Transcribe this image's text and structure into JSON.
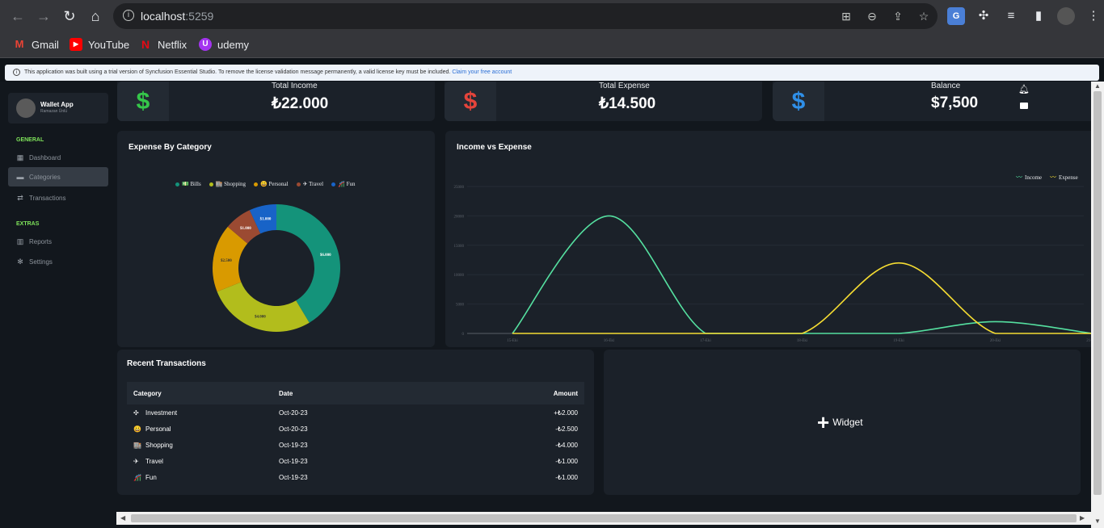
{
  "browser": {
    "url_host": "localhost",
    "url_port": ":5259",
    "ext_translate": "G"
  },
  "bookmarks": [
    {
      "label": "Gmail",
      "icon": "gmail-icon",
      "icon_text": "M",
      "color": "#ea4335"
    },
    {
      "label": "YouTube",
      "icon": "youtube-icon",
      "icon_text": "▶",
      "color": "#ff0000"
    },
    {
      "label": "Netflix",
      "icon": "netflix-icon",
      "icon_text": "N",
      "color": "#e50914"
    },
    {
      "label": "udemy",
      "icon": "udemy-icon",
      "icon_text": "U",
      "color": "#a435f0"
    }
  ],
  "banner": {
    "text": "This application was built using a trial version of Syncfusion Essential Studio. To remove the license validation message permanently, a valid license key must be included.",
    "link": "Claim your free account"
  },
  "sidebar": {
    "app_name": "Wallet App",
    "user_sub": "Ramazan Ünlü",
    "general_label": "GENERAL",
    "extras_label": "EXTRAS",
    "items": [
      {
        "label": "Dashboard",
        "icon": "calendar-icon"
      },
      {
        "label": "Categories",
        "icon": "folder-icon"
      },
      {
        "label": "Transactions",
        "icon": "exchange-icon"
      },
      {
        "label": "Reports",
        "icon": "bar-chart-icon"
      },
      {
        "label": "Settings",
        "icon": "gear-icon"
      }
    ]
  },
  "stats": [
    {
      "label": "Total Income",
      "value": "₺22.000",
      "color": "#35c74a"
    },
    {
      "label": "Total Expense",
      "value": "₺14.500",
      "color": "#e5443b"
    },
    {
      "label": "Balance",
      "value": "$7,500",
      "color": "#2f8fe8"
    }
  ],
  "donut": {
    "title": "Expense By Category",
    "legend": [
      "💵 Bills",
      "🏬 Shopping",
      "😀 Personal",
      "✈ Travel",
      "🎢 Fun"
    ],
    "colors": [
      "#14937a",
      "#b2bd1c",
      "#d99a00",
      "#9b4a32",
      "#1863c7"
    ]
  },
  "line": {
    "title": "Income vs Expense",
    "legend": [
      "Income",
      "Expense"
    ],
    "colors": [
      "#55e0a0",
      "#f5dc32"
    ],
    "y_ticks": [
      "25000",
      "20000",
      "15000",
      "10000",
      "5000",
      "0"
    ],
    "x_ticks": [
      "15-Eki",
      "16-Eki",
      "17-Eki",
      "18-Eki",
      "19-Eki",
      "20-Eki",
      "21-Eki"
    ]
  },
  "chart_data": [
    {
      "type": "pie",
      "title": "Expense By Category",
      "categories": [
        "Bills",
        "Shopping",
        "Personal",
        "Travel",
        "Fun"
      ],
      "values": [
        6000,
        4000,
        2500,
        1000,
        1000
      ],
      "labels": [
        "$6.000",
        "$4.000",
        "$2.500",
        "$1.000",
        "$1.000"
      ]
    },
    {
      "type": "line",
      "title": "Income vs Expense",
      "categories": [
        "15-Eki",
        "16-Eki",
        "17-Eki",
        "18-Eki",
        "19-Eki",
        "20-Eki",
        "21-Eki"
      ],
      "ylim": [
        0,
        25000
      ],
      "series": [
        {
          "name": "Income",
          "values": [
            0,
            20000,
            0,
            0,
            0,
            2000,
            0
          ]
        },
        {
          "name": "Expense",
          "values": [
            0,
            0,
            0,
            0,
            12000,
            0,
            0
          ]
        }
      ]
    }
  ],
  "transactions": {
    "title": "Recent Transactions",
    "headers": [
      "Category",
      "Date",
      "Amount"
    ],
    "rows": [
      {
        "icon": "✣",
        "category": "Investment",
        "date": "Oct-20-23",
        "amount": "+₺2.000"
      },
      {
        "icon": "😀",
        "category": "Personal",
        "date": "Oct-20-23",
        "amount": "-₺2.500"
      },
      {
        "icon": "🏬",
        "category": "Shopping",
        "date": "Oct-19-23",
        "amount": "-₺4.000"
      },
      {
        "icon": "✈",
        "category": "Travel",
        "date": "Oct-19-23",
        "amount": "-₺1.000"
      },
      {
        "icon": "🎢",
        "category": "Fun",
        "date": "Oct-19-23",
        "amount": "-₺1.000"
      }
    ]
  },
  "widget": {
    "label": "Widget"
  }
}
